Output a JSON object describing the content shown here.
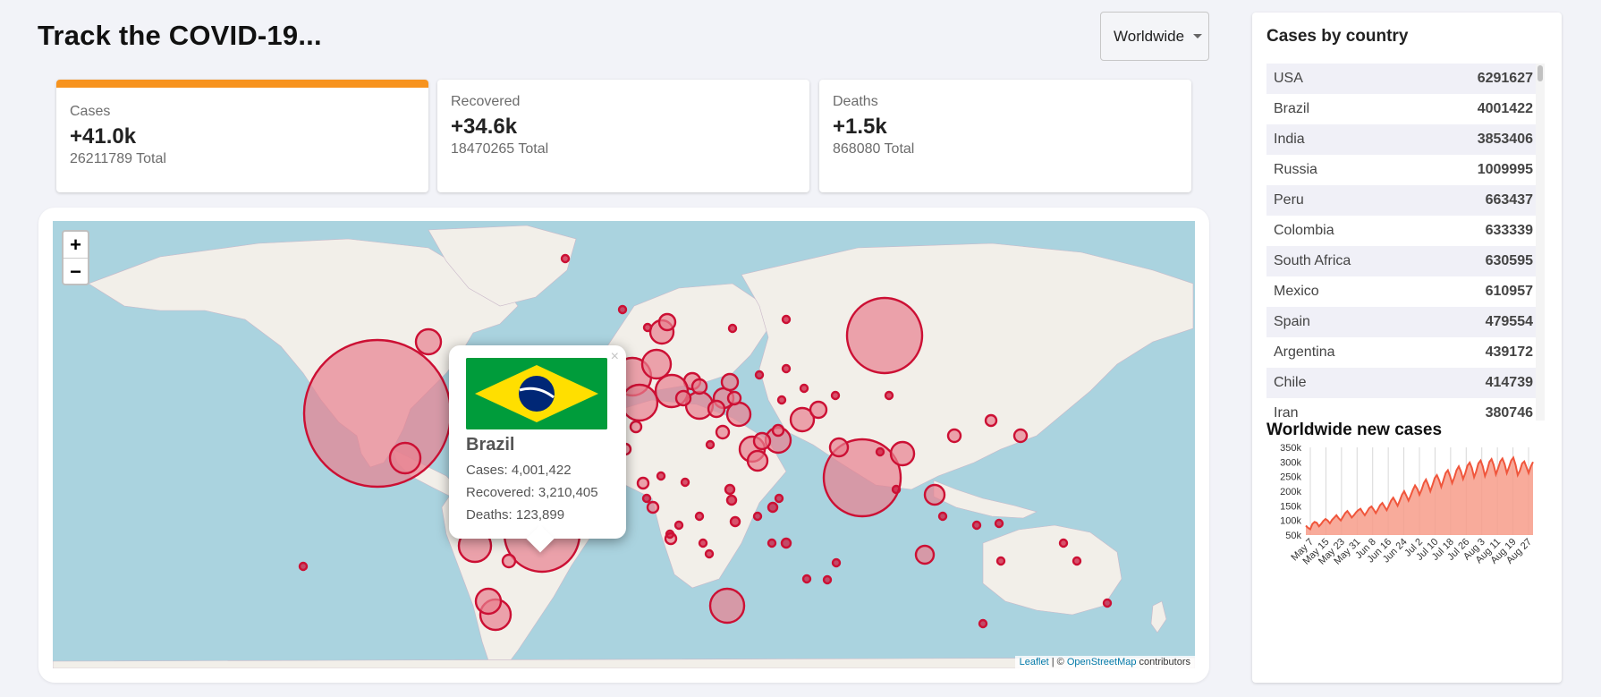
{
  "app": {
    "title": "Track the COVID-19..."
  },
  "region_select": {
    "value": "Worldwide"
  },
  "stats": [
    {
      "title": "Cases",
      "delta": "+41.0k",
      "total": "26211789 Total",
      "active": true
    },
    {
      "title": "Recovered",
      "delta": "+34.6k",
      "total": "18470265 Total",
      "active": false
    },
    {
      "title": "Deaths",
      "delta": "+1.5k",
      "total": "868080 Total",
      "active": false
    }
  ],
  "map": {
    "zoom_in": "+",
    "zoom_out": "−",
    "attribution": {
      "leaflet": "Leaflet",
      "separator": " | © ",
      "osm": "OpenStreetMap",
      "suffix": " contributors"
    },
    "popup": {
      "close": "×",
      "country": "Brazil",
      "cases": "Cases: 4,001,422",
      "recovered": "Recovered: 3,210,405",
      "deaths": "Deaths: 123,899"
    },
    "colors": {
      "ocean": "#aad3df",
      "land": "#f2efe9",
      "circle_fill": "#e8808f",
      "circle_stroke": "#cc1034"
    }
  },
  "sidebar": {
    "title": "Cases by country",
    "countries": [
      {
        "name": "USA",
        "cases": "6291627"
      },
      {
        "name": "Brazil",
        "cases": "4001422"
      },
      {
        "name": "India",
        "cases": "3853406"
      },
      {
        "name": "Russia",
        "cases": "1009995"
      },
      {
        "name": "Peru",
        "cases": "663437"
      },
      {
        "name": "Colombia",
        "cases": "633339"
      },
      {
        "name": "South Africa",
        "cases": "630595"
      },
      {
        "name": "Mexico",
        "cases": "610957"
      },
      {
        "name": "Spain",
        "cases": "479554"
      },
      {
        "name": "Argentina",
        "cases": "439172"
      },
      {
        "name": "Chile",
        "cases": "414739"
      },
      {
        "name": "Iran",
        "cases": "380746"
      }
    ],
    "graph_title": "Worldwide new cases"
  },
  "chart_data": {
    "type": "area",
    "title": "Worldwide new cases",
    "x_tick_labels": [
      "May 7",
      "May 15",
      "May 23",
      "May 31",
      "Jun 8",
      "Jun 16",
      "Jun 24",
      "Jul 2",
      "Jul 10",
      "Jul 18",
      "Jul 26",
      "Aug 3",
      "Aug 11",
      "Aug 19",
      "Aug 27"
    ],
    "y_tick_labels": [
      "50k",
      "100k",
      "150k",
      "200k",
      "250k",
      "300k",
      "350k"
    ],
    "ylim": [
      50000,
      350000
    ],
    "values": [
      82000,
      75000,
      70000,
      88000,
      95000,
      92000,
      80000,
      88000,
      98000,
      105000,
      100000,
      90000,
      102000,
      110000,
      118000,
      108000,
      100000,
      112000,
      125000,
      132000,
      122000,
      110000,
      118000,
      128000,
      135000,
      140000,
      128000,
      118000,
      130000,
      142000,
      148000,
      138000,
      125000,
      138000,
      152000,
      160000,
      148000,
      135000,
      150000,
      168000,
      178000,
      165000,
      150000,
      168000,
      188000,
      200000,
      185000,
      168000,
      185000,
      205000,
      220000,
      208000,
      188000,
      205000,
      228000,
      240000,
      222000,
      200000,
      222000,
      245000,
      255000,
      238000,
      215000,
      238000,
      262000,
      272000,
      252000,
      228000,
      248000,
      272000,
      285000,
      268000,
      242000,
      262000,
      288000,
      298000,
      280000,
      248000,
      268000,
      295000,
      305000,
      285000,
      252000,
      272000,
      300000,
      310000,
      290000,
      258000,
      278000,
      302000,
      312000,
      292000,
      262000,
      282000,
      305000,
      315000,
      290000,
      255000,
      270000,
      295000,
      302000,
      282000,
      262000,
      285000,
      300000
    ],
    "colors": {
      "line": "#f0563c",
      "fill": "#f79c8a"
    },
    "grid": "vertical"
  }
}
